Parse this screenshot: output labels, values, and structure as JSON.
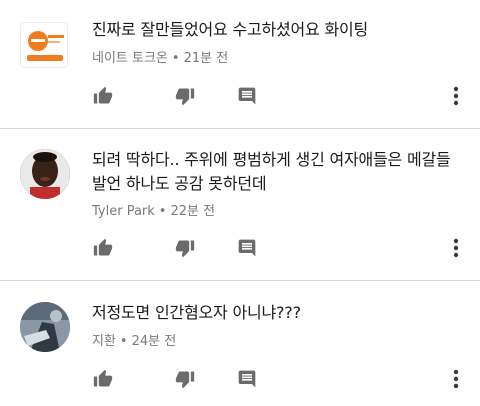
{
  "comments": [
    {
      "author": "네이트 토크온",
      "time": "21분 전",
      "text": "진짜로 잘만들었어요 수고하셨어요 화이팅",
      "avatar_label": "토크온",
      "avatar_icon": "talkon-logo-icon"
    },
    {
      "author": "Tyler Park",
      "time": "22분 전",
      "text": "되려 딱하다.. 주위에 평범하게 생긴 여자애들은 메갈들 발언 하나도 공감 못하던데",
      "avatar_icon": "user-photo-avatar"
    },
    {
      "author": "지환",
      "time": "24분 전",
      "text": "저정도면 인간혐오자 아니냐???",
      "avatar_icon": "user-photo-avatar"
    }
  ],
  "actions": {
    "like_icon": "thumbs-up-icon",
    "dislike_icon": "thumbs-down-icon",
    "reply_icon": "reply-icon",
    "more_icon": "more-vertical-icon"
  },
  "colors": {
    "icon": "#6b6b6b",
    "meta_text": "#7a7a7a",
    "divider": "#d9d9d9",
    "talkon_orange": "#f07c1c"
  }
}
